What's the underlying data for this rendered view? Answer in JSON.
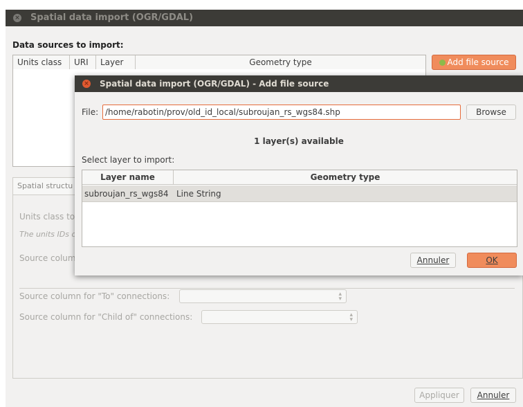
{
  "background_window": {
    "title": "Spatial data import (OGR/GDAL)",
    "section_label": "Data sources to import:",
    "table_columns": [
      "Units class",
      "URI",
      "Layer",
      "Geometry type"
    ],
    "add_source_label": "Add file source",
    "group_tab": "Spatial structu",
    "units_class_label": "Units class to",
    "units_ids_note": "The units IDs c",
    "source_column_label": "Source colum",
    "to_connections_label": "Source column for \"To\" connections:",
    "child_connections_label": "Source column for \"Child of\" connections:",
    "apply_label": "Appliquer",
    "cancel_label": "Annuler"
  },
  "dialog": {
    "title": "Spatial data import (OGR/GDAL) - Add file source",
    "file_label": "File:",
    "file_path": "/home/rabotin/prov/old_id_local/subroujan_rs_wgs84.shp",
    "browse_label": "Browse",
    "layers_available": "1 layer(s) available",
    "select_label": "Select layer to import:",
    "layer_columns": [
      "Layer name",
      "Geometry type"
    ],
    "layers": [
      {
        "name": "subroujan_rs_wgs84",
        "geometry": "Line String"
      }
    ],
    "cancel_label": "Annuler",
    "ok_label": "OK"
  },
  "colors": {
    "accent": "#f08c5c",
    "titlebar": "#3c3b37",
    "close_button": "#e05a31"
  }
}
